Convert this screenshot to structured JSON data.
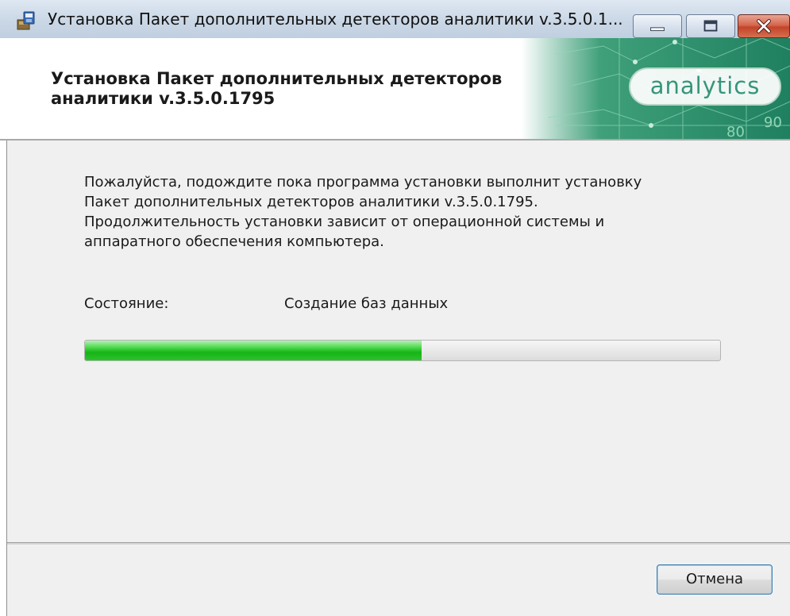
{
  "window": {
    "title": "Установка Пакет дополнительных детекторов аналитики v.3.5.0.1...",
    "controls": [
      "minimize",
      "maximize",
      "close"
    ]
  },
  "banner": {
    "title_line1": "Установка Пакет дополнительных детекторов",
    "title_line2": "аналитики v.3.5.0.1795",
    "logo_text": "analytics",
    "background_numbers": [
      "80",
      "90"
    ]
  },
  "main": {
    "intro_lines": [
      "Пожалуйста, подождите пока программа установки выполнит установку",
      "Пакет дополнительных детекторов аналитики v.3.5.0.1795.",
      "Продолжительность установки зависит от операционной системы и",
      "аппаратного обеспечения компьютера."
    ],
    "status_label": "Состояние:",
    "status_value": "Создание баз данных",
    "progress": 0.53
  },
  "footer": {
    "cancel_label": "Отмена"
  },
  "colors": {
    "progress_green": "#16b416",
    "logo_green": "#36957a",
    "panel_bg": "#f0f0f0"
  }
}
